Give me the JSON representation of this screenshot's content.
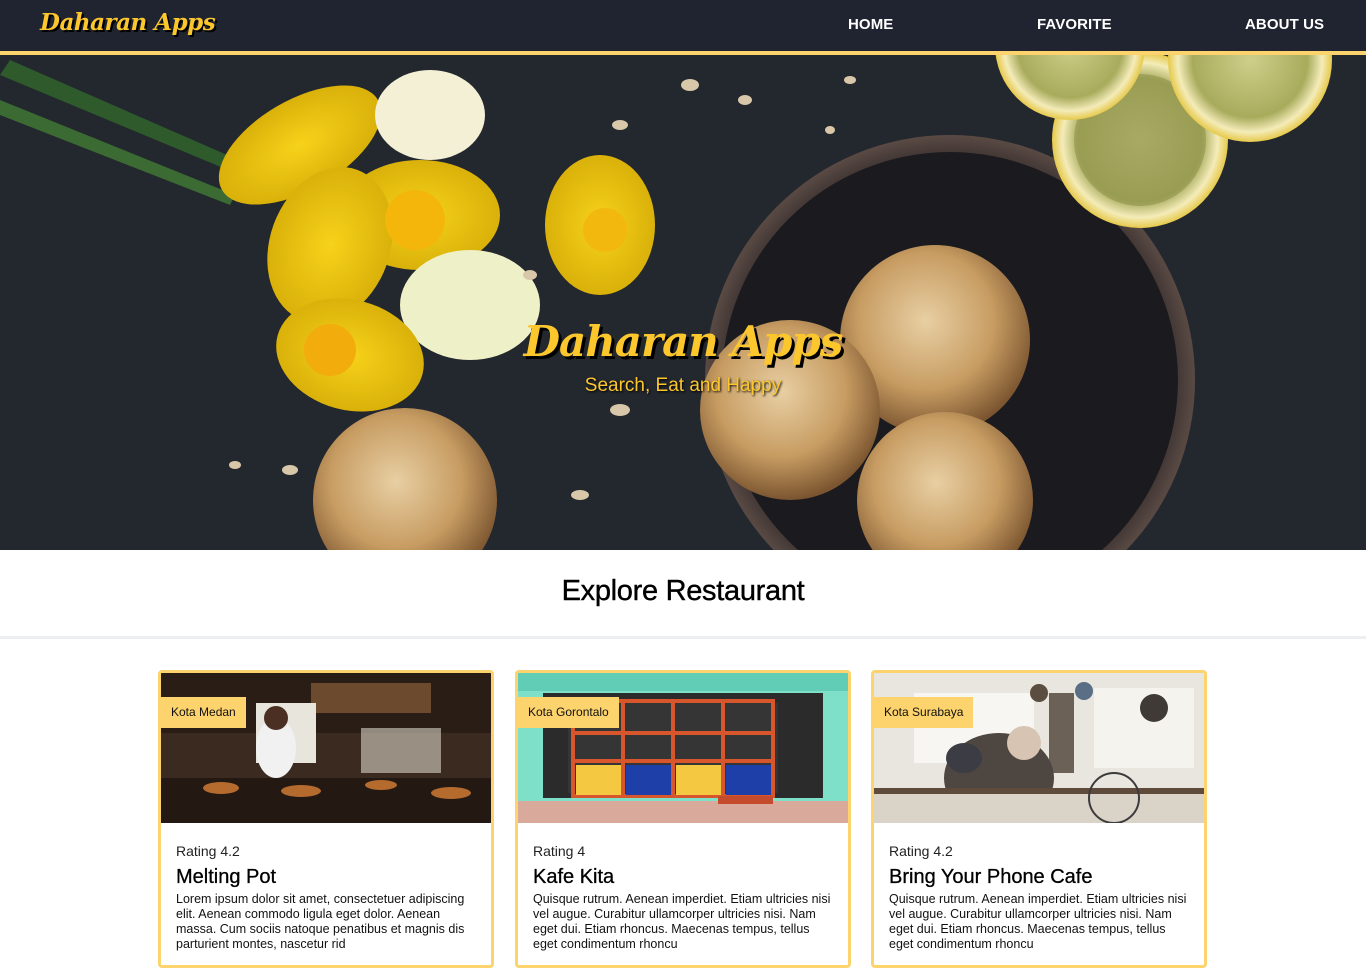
{
  "navbar": {
    "brand": "Daharan Apps",
    "links": [
      {
        "label": "HOME"
      },
      {
        "label": "FAVORITE"
      },
      {
        "label": "ABOUT US"
      }
    ],
    "accent_color": "#fcd36c",
    "background_color": "#1f2430"
  },
  "hero": {
    "title": "Daharan Apps",
    "tagline": "Search, Eat and Happy",
    "text_color": "#fcc72c"
  },
  "section": {
    "title": "Explore Restaurant"
  },
  "restaurants": [
    {
      "city": "Kota Medan",
      "rating": "Rating 4.2",
      "name": "Melting Pot",
      "description": "Lorem ipsum dolor sit amet, consectetuer adipiscing elit. Aenean commodo ligula eget dolor. Aenean massa. Cum sociis natoque penatibus et magnis dis parturient montes, nascetur rid"
    },
    {
      "city": "Kota Gorontalo",
      "rating": "Rating 4",
      "name": "Kafe Kita",
      "description": "Quisque rutrum. Aenean imperdiet. Etiam ultricies nisi vel augue. Curabitur ullamcorper ultricies nisi. Nam eget dui. Etiam rhoncus. Maecenas tempus, tellus eget condimentum rhoncu"
    },
    {
      "city": "Kota Surabaya",
      "rating": "Rating 4.2",
      "name": "Bring Your Phone Cafe",
      "description": "Quisque rutrum. Aenean imperdiet. Etiam ultricies nisi vel augue. Curabitur ullamcorper ultricies nisi. Nam eget dui. Etiam rhoncus. Maecenas tempus, tellus eget condimentum rhoncu"
    }
  ]
}
